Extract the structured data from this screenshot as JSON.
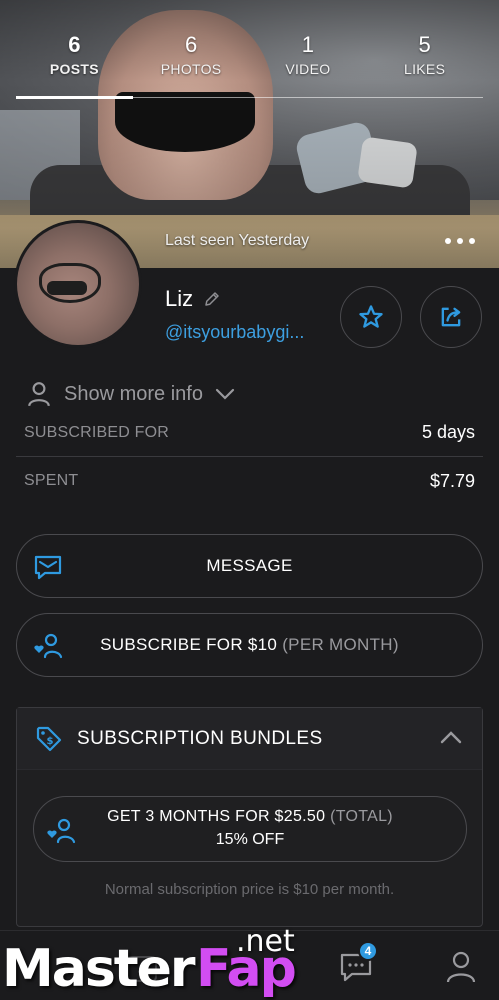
{
  "stats": [
    {
      "count": "6",
      "label": "POSTS",
      "active": true
    },
    {
      "count": "6",
      "label": "PHOTOS",
      "active": false
    },
    {
      "count": "1",
      "label": "VIDEO",
      "active": false
    },
    {
      "count": "5",
      "label": "LIKES",
      "active": false
    }
  ],
  "profile": {
    "last_seen": "Last seen Yesterday",
    "name": "Liz",
    "handle": "@itsyourbabygi..."
  },
  "info": {
    "show_more_label": "Show more info",
    "subscribed_for_label": "SUBSCRIBED FOR",
    "subscribed_for_value": "5 days",
    "spent_label": "SPENT",
    "spent_value": "$7.79"
  },
  "actions": {
    "message_label": "MESSAGE",
    "subscribe_label": "SUBSCRIBE FOR $10",
    "subscribe_sub": "(PER MONTH)"
  },
  "bundles": {
    "title": "SUBSCRIPTION BUNDLES",
    "bundle_main": "GET 3 MONTHS FOR $25.50",
    "bundle_sub": "(TOTAL)",
    "bundle_discount": "15% OFF",
    "normal_note": "Normal subscription price is $10 per month."
  },
  "nav": {
    "chat_badge": "4"
  },
  "watermark": {
    "part1": "Master",
    "part2": "Fap",
    "part3": ".net"
  },
  "colors": {
    "accent": "#3d9fe0",
    "background": "#1b1b1d",
    "watermark_fap": "#d24df2"
  }
}
